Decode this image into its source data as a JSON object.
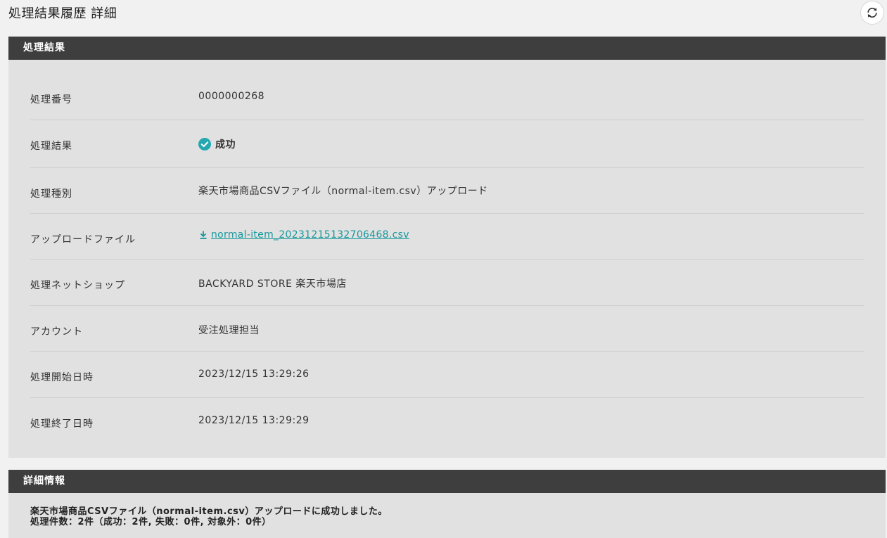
{
  "page": {
    "title": "処理結果履歴 詳細"
  },
  "icons": {
    "refresh": "refresh-icon",
    "success": "check-circle-icon",
    "download": "download-icon"
  },
  "colors": {
    "header_bg": "#3e3e3e",
    "section_bg": "#e1e1e1",
    "accent": "#16989c",
    "success": "#26a8b0"
  },
  "result_section": {
    "heading": "処理結果",
    "rows": [
      {
        "label": "処理番号",
        "value": "0000000268"
      },
      {
        "label": "処理結果",
        "value": "成功"
      },
      {
        "label": "処理種別",
        "value": "楽天市場商品CSVファイル（normal-item.csv）アップロード"
      },
      {
        "label": "アップロードファイル",
        "value": "normal-item_20231215132706468.csv"
      },
      {
        "label": "処理ネットショップ",
        "value": "BACKYARD STORE 楽天市場店"
      },
      {
        "label": "アカウント",
        "value": "受注処理担当"
      },
      {
        "label": "処理開始日時",
        "value": "2023/12/15 13:29:26"
      },
      {
        "label": "処理終了日時",
        "value": "2023/12/15 13:29:29"
      }
    ]
  },
  "detail_section": {
    "heading": "詳細情報",
    "lines": [
      "楽天市場商品CSVファイル（normal-item.csv）アップロードに成功しました。",
      "処理件数：2件（成功：2件, 失敗：0件, 対象外：0件）"
    ]
  }
}
